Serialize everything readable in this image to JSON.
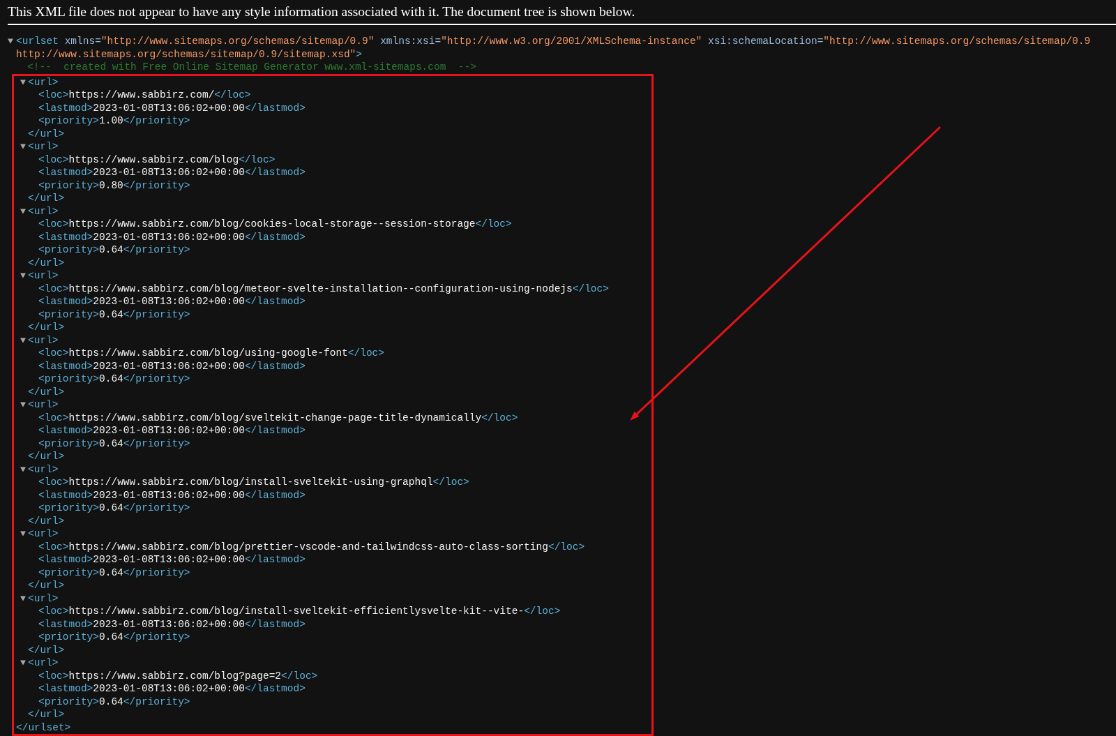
{
  "header": {
    "message": "This XML file does not appear to have any style information associated with it. The document tree is shown below."
  },
  "xml_tree": {
    "expanded": true,
    "open_tag": {
      "name": "<urlset",
      "attributes": [
        {
          "name": "xmlns=",
          "value": "\"http://www.sitemaps.org/schemas/sitemap/0.9\""
        },
        {
          "name": "xmlns:xsi=",
          "value": "\"http://www.w3.org/2001/XMLSchema-instance\""
        },
        {
          "name": "xsi:schemaLocation=",
          "value": "\"http://www.sitemaps.org/schemas/sitemap/0.9 http://www.sitemaps.org/schemas/sitemap/0.9/sitemap.xsd\""
        }
      ],
      "end": ">"
    },
    "comment": "<!--  created with Free Online Sitemap Generator www.xml-sitemaps.com  -->",
    "urls": [
      {
        "expanded": true,
        "open_tag": "<url>",
        "fields": [
          {
            "open": "<loc>",
            "text": "https://www.sabbirz.com/",
            "close": "</loc>"
          },
          {
            "open": "<lastmod>",
            "text": "2023-01-08T13:06:02+00:00",
            "close": "</lastmod>"
          },
          {
            "open": "<priority>",
            "text": "1.00",
            "close": "</priority>"
          }
        ],
        "close_tag": "</url>"
      },
      {
        "expanded": true,
        "open_tag": "<url>",
        "fields": [
          {
            "open": "<loc>",
            "text": "https://www.sabbirz.com/blog",
            "close": "</loc>"
          },
          {
            "open": "<lastmod>",
            "text": "2023-01-08T13:06:02+00:00",
            "close": "</lastmod>"
          },
          {
            "open": "<priority>",
            "text": "0.80",
            "close": "</priority>"
          }
        ],
        "close_tag": "</url>"
      },
      {
        "expanded": true,
        "open_tag": "<url>",
        "fields": [
          {
            "open": "<loc>",
            "text": "https://www.sabbirz.com/blog/cookies-local-storage--session-storage",
            "close": "</loc>"
          },
          {
            "open": "<lastmod>",
            "text": "2023-01-08T13:06:02+00:00",
            "close": "</lastmod>"
          },
          {
            "open": "<priority>",
            "text": "0.64",
            "close": "</priority>"
          }
        ],
        "close_tag": "</url>"
      },
      {
        "expanded": true,
        "open_tag": "<url>",
        "fields": [
          {
            "open": "<loc>",
            "text": "https://www.sabbirz.com/blog/meteor-svelte-installation--configuration-using-nodejs",
            "close": "</loc>"
          },
          {
            "open": "<lastmod>",
            "text": "2023-01-08T13:06:02+00:00",
            "close": "</lastmod>"
          },
          {
            "open": "<priority>",
            "text": "0.64",
            "close": "</priority>"
          }
        ],
        "close_tag": "</url>"
      },
      {
        "expanded": true,
        "open_tag": "<url>",
        "fields": [
          {
            "open": "<loc>",
            "text": "https://www.sabbirz.com/blog/using-google-font",
            "close": "</loc>"
          },
          {
            "open": "<lastmod>",
            "text": "2023-01-08T13:06:02+00:00",
            "close": "</lastmod>"
          },
          {
            "open": "<priority>",
            "text": "0.64",
            "close": "</priority>"
          }
        ],
        "close_tag": "</url>"
      },
      {
        "expanded": true,
        "open_tag": "<url>",
        "fields": [
          {
            "open": "<loc>",
            "text": "https://www.sabbirz.com/blog/sveltekit-change-page-title-dynamically",
            "close": "</loc>"
          },
          {
            "open": "<lastmod>",
            "text": "2023-01-08T13:06:02+00:00",
            "close": "</lastmod>"
          },
          {
            "open": "<priority>",
            "text": "0.64",
            "close": "</priority>"
          }
        ],
        "close_tag": "</url>"
      },
      {
        "expanded": true,
        "open_tag": "<url>",
        "fields": [
          {
            "open": "<loc>",
            "text": "https://www.sabbirz.com/blog/install-sveltekit-using-graphql",
            "close": "</loc>"
          },
          {
            "open": "<lastmod>",
            "text": "2023-01-08T13:06:02+00:00",
            "close": "</lastmod>"
          },
          {
            "open": "<priority>",
            "text": "0.64",
            "close": "</priority>"
          }
        ],
        "close_tag": "</url>"
      },
      {
        "expanded": true,
        "open_tag": "<url>",
        "fields": [
          {
            "open": "<loc>",
            "text": "https://www.sabbirz.com/blog/prettier-vscode-and-tailwindcss-auto-class-sorting",
            "close": "</loc>"
          },
          {
            "open": "<lastmod>",
            "text": "2023-01-08T13:06:02+00:00",
            "close": "</lastmod>"
          },
          {
            "open": "<priority>",
            "text": "0.64",
            "close": "</priority>"
          }
        ],
        "close_tag": "</url>"
      },
      {
        "expanded": true,
        "open_tag": "<url>",
        "fields": [
          {
            "open": "<loc>",
            "text": "https://www.sabbirz.com/blog/install-sveltekit-efficientlysvelte-kit--vite-",
            "close": "</loc>"
          },
          {
            "open": "<lastmod>",
            "text": "2023-01-08T13:06:02+00:00",
            "close": "</lastmod>"
          },
          {
            "open": "<priority>",
            "text": "0.64",
            "close": "</priority>"
          }
        ],
        "close_tag": "</url>"
      },
      {
        "expanded": true,
        "open_tag": "<url>",
        "fields": [
          {
            "open": "<loc>",
            "text": "https://www.sabbirz.com/blog?page=2",
            "close": "</loc>"
          },
          {
            "open": "<lastmod>",
            "text": "2023-01-08T13:06:02+00:00",
            "close": "</lastmod>"
          },
          {
            "open": "<priority>",
            "text": "0.64",
            "close": "</priority>"
          }
        ],
        "close_tag": "</url>"
      }
    ],
    "close_tag": "</urlset>"
  }
}
